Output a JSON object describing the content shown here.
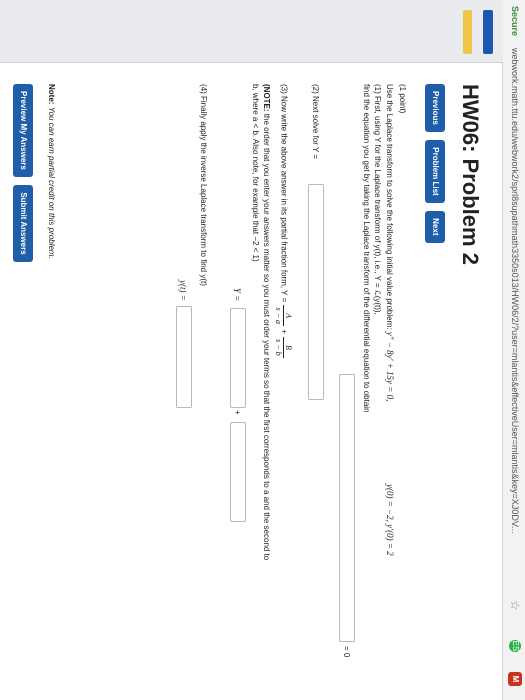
{
  "browser": {
    "secure_label": "Secure",
    "url": "webwork.math.ttu.edu/webwork2/sprl8supathmath3350s013/HW06/2/?user=mlantis&effectiveUser=mlantis&key=XJ0DV...",
    "star_icon": "star-icon",
    "ext1_label": "ES",
    "ext2_label": "M"
  },
  "page": {
    "title": "HW06: Problem 2",
    "nav": {
      "previous": "Previous",
      "problem_list": "Problem List",
      "next": "Next"
    },
    "points": "(1 point)",
    "intro": "Use the Laplace transform to solve the following initial value problem:",
    "ivp_eq": "y″ − 8y′ + 15y = 0,",
    "ivp_init": "y(0) = −2,  y′(0) = 2",
    "step1_a": "(1) First, using Y for the Laplace transform of y(t), i.e., Y = ℒ(y(t)),",
    "step1_b": "find the equation you get by taking the Laplace transform of the differential equation to obtain",
    "eq_zero": "= 0",
    "step2": "(2) Next solve for Y =",
    "step3": "(3) Now write the above answer in its partial fraction form, Y =",
    "frac_A_num": "A",
    "frac_A_den": "s − a",
    "frac_B_num": "B",
    "frac_B_den": "s − b",
    "note_label": "(NOTE:",
    "note_rest": "the order that you enter your answers matter so you must order your terms so that the first corresponds to a and the second to",
    "note_line2": "b, where a < b. Also note, for example that −2 < 1)",
    "y_eq": "Y =",
    "plus": "+",
    "step4": "(4) Finally apply the inverse Laplace transform to find y(t)",
    "yt_eq": "y(t) =",
    "footnote_bold": "Note:",
    "footnote_rest": "You can earn partial credit on this problem.",
    "preview_btn": "Preview My Answers",
    "submit_btn": "Submit Answers"
  }
}
